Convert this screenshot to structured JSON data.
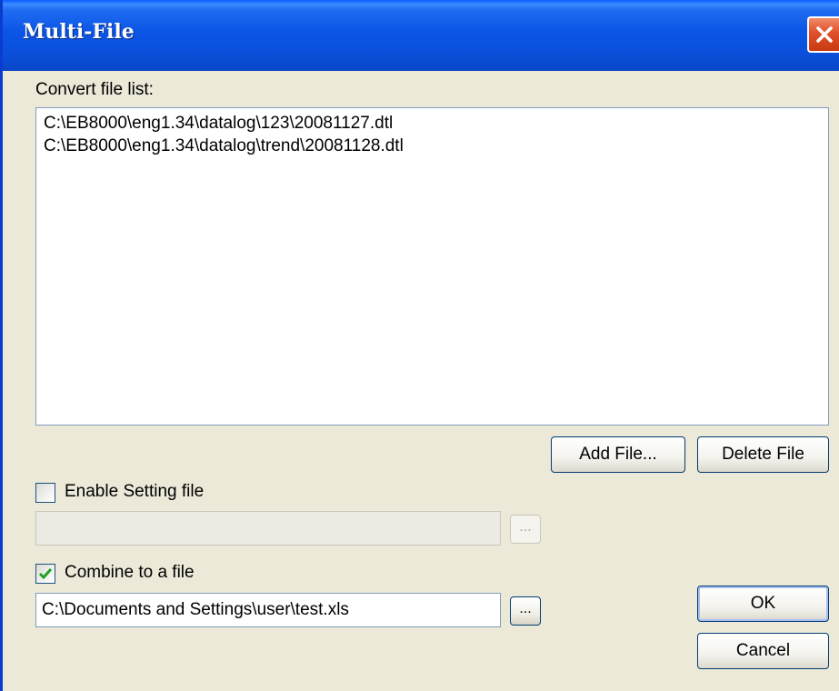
{
  "window": {
    "title": "Multi-File"
  },
  "file_list": {
    "label": "Convert file list:",
    "items": [
      "C:\\EB8000\\eng1.34\\datalog\\123\\20081127.dtl",
      "C:\\EB8000\\eng1.34\\datalog\\trend\\20081128.dtl"
    ]
  },
  "buttons": {
    "add_file": "Add File...",
    "delete_file": "Delete File",
    "ok": "OK",
    "cancel": "Cancel",
    "browse": "..."
  },
  "setting_file": {
    "label": "Enable Setting file",
    "checked": false,
    "value": ""
  },
  "combine": {
    "label": "Combine to a file",
    "checked": true,
    "value": "C:\\Documents and Settings\\user\\test.xls"
  },
  "colors": {
    "titlebar": "#0a50dd",
    "close_button": "#e0502a",
    "dialog_background": "#ece9d8",
    "check_mark": "#21a121"
  }
}
